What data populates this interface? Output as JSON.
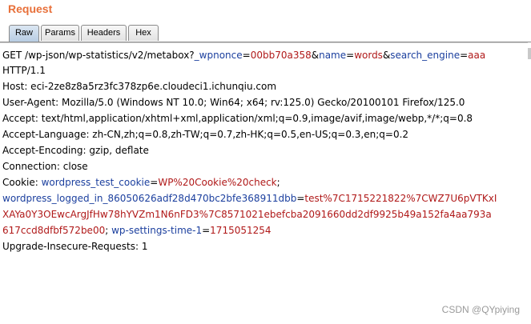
{
  "panel": {
    "title": "Request"
  },
  "tabs": [
    {
      "label": "Raw",
      "active": true
    },
    {
      "label": "Params",
      "active": false
    },
    {
      "label": "Headers",
      "active": false
    },
    {
      "label": "Hex",
      "active": false
    }
  ],
  "request": {
    "line1": {
      "prefix": "GET /wp-json/wp-statistics/v2/metabox?",
      "p1_name": "_wpnonce",
      "eq1": "=",
      "p1_value": "00bb70a358",
      "amp1": "&",
      "p2_name": "name",
      "eq2": "=",
      "p2_value": "words",
      "amp2": "&",
      "p3_name": "search_engine",
      "eq3": "=",
      "p3_value": "aaa"
    },
    "line2": "HTTP/1.1",
    "host": "Host: eci-2ze8z8a5rz3fc378zp6e.cloudeci1.ichunqiu.com",
    "user_agent": "User-Agent: Mozilla/5.0 (Windows NT 10.0; Win64; x64; rv:125.0) Gecko/20100101 Firefox/125.0",
    "accept": "Accept: text/html,application/xhtml+xml,application/xml;q=0.9,image/avif,image/webp,*/*;q=0.8",
    "accept_language": "Accept-Language: zh-CN,zh;q=0.8,zh-TW;q=0.7,zh-HK;q=0.5,en-US;q=0.3,en;q=0.2",
    "accept_encoding": "Accept-Encoding: gzip, deflate",
    "connection": "Connection: close",
    "cookie": {
      "label": "Cookie: ",
      "c1_name": "wordpress_test_cookie",
      "eq1": "=",
      "c1_value": "WP%20Cookie%20check",
      "sep1": ";",
      "c2_name": "wordpress_logged_in_86050626adf28d470bc2bfe368911dbb",
      "eq2": "=",
      "c2_value_a": "test%7C1715221822%7CWZ7U6pVTKxI",
      "c2_value_b": "XAYa0Y3OEwcArgJfHw78hYVZm1N6nFD3%7C8571021ebefcba2091660dd2df9925b49a152fa4aa793a",
      "c2_value_c": "617ccd8dfbf572be00",
      "sep2": "; ",
      "c3_name": "wp-settings-time-1",
      "eq3": "=",
      "c3_value": "1715051254"
    },
    "upgrade": "Upgrade-Insecure-Requests: 1"
  },
  "watermark": "CSDN @QYpiying"
}
